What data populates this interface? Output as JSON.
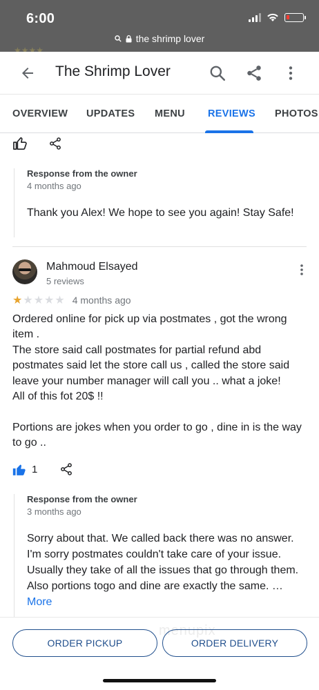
{
  "status_bar": {
    "time": "6:00",
    "url": "the shrimp lover",
    "icons": [
      "signal-icon",
      "wifi-icon",
      "battery-low-icon",
      "lock-icon"
    ]
  },
  "header": {
    "title": "The Shrimp Lover",
    "actions": [
      "back-arrow-icon",
      "search-icon",
      "share-icon",
      "more-vert-icon"
    ]
  },
  "tabs": [
    {
      "label": "OVERVIEW",
      "active": false
    },
    {
      "label": "UPDATES",
      "active": false
    },
    {
      "label": "MENU",
      "active": false
    },
    {
      "label": "REVIEWS",
      "active": true
    },
    {
      "label": "PHOTOS",
      "active": false
    }
  ],
  "reviews": [
    {
      "owner_response": {
        "label": "Response from the owner",
        "time": "4 months ago",
        "text": "Thank you Alex! We hope to see you again! Stay Safe!"
      }
    },
    {
      "reviewer": "Mahmoud Elsayed",
      "meta": "5 reviews",
      "rating": 1,
      "rating_max": 5,
      "time": "4 months ago",
      "text": "Ordered online for pick up via postmates , got the wrong item .\nThe store said call postmates for partial refund abd postmates said let the store call us , called the store said leave your number manager will call you .. what a joke!\nAll of this fot 20$ !!\n\nPortions are jokes when you order to go , dine in is the way to go ..",
      "likes": "1",
      "owner_response": {
        "label": "Response from the owner",
        "time": "3 months ago",
        "text": "Sorry about that. We called back there was no answer. I'm sorry postmates couldn't take care of your issue. Usually they take of all the issues that go through them. Also portions togo and dine are exactly the same. … ",
        "more_label": "More"
      }
    }
  ],
  "footer": {
    "order_pickup": "ORDER PICKUP",
    "order_delivery": "ORDER DELIVERY",
    "watermark": "menupix"
  },
  "colors": {
    "accent": "#1a73e8",
    "footer_button": "#1f4e8c",
    "star_on": "#e8a42e",
    "status_bar_bg": "#5f5f5f"
  }
}
